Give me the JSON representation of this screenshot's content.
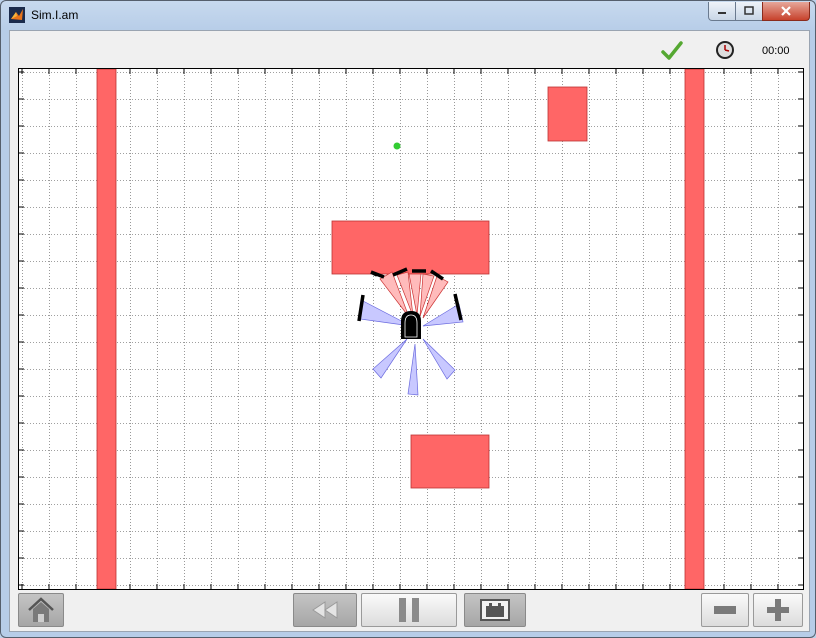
{
  "window": {
    "title": "Sim.I.am",
    "controls": [
      "minimize-icon",
      "maximize-icon",
      "close-icon"
    ]
  },
  "status": {
    "indicator_icon": "checkmark-icon",
    "indicator_color": "#55a832",
    "clock_icon": "clock-icon",
    "time": "00:00"
  },
  "arena": {
    "grid": true,
    "obstacle_color": "#ff6666",
    "goal_color": "#33cc33",
    "ir_sensor_color": "#ffbbbb",
    "ultrasonic_sensor_color": "#c8c8ff",
    "robot_color": "#000000"
  },
  "toolbar": {
    "home_icon": "home-icon",
    "rewind_icon": "rewind-icon",
    "pause_icon": "pause-icon",
    "robot_view_icon": "robot-view-icon",
    "zoom_out_icon": "zoom-out-icon",
    "zoom_in_icon": "zoom-in-icon"
  }
}
